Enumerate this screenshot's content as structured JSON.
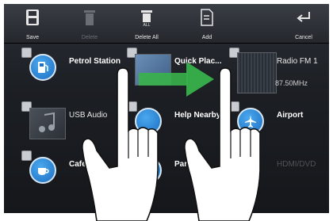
{
  "toolbar": {
    "save": "Save",
    "delete": "Delete",
    "delete_all": "Delete All",
    "add": "Add",
    "cancel": "Cancel"
  },
  "tiles": [
    {
      "label": "Petrol Station",
      "icon": "fuel-pump-icon"
    },
    {
      "label": "Quick Plac...",
      "icon": "map-thumbnail-icon"
    },
    {
      "label": "Radio FM 1",
      "sub": "87.50MHz",
      "icon": "radio-spectrum-icon"
    },
    {
      "label": "USB Audio",
      "icon": "music-note-icon"
    },
    {
      "label": "Help Nearby",
      "icon": "help-icon"
    },
    {
      "label": "Airport",
      "icon": "airplane-icon"
    },
    {
      "label": "Cafe/Ba",
      "icon": "coffee-cup-icon"
    },
    {
      "label": "Parkin",
      "icon": "parking-icon"
    },
    {
      "label": "HDMI/DVD",
      "icon": "hdmi-icon"
    }
  ],
  "colors": {
    "accent_blue": "#2a86dd",
    "arrow_green": "#38b24a"
  }
}
